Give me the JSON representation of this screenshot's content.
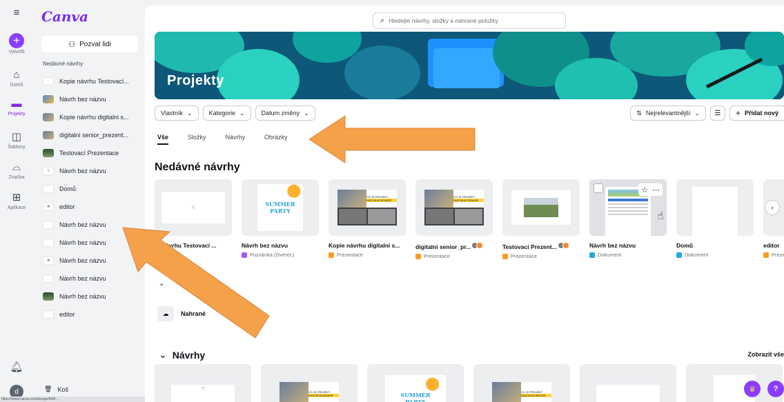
{
  "rail": {
    "create_label": "Vytvořit",
    "home_label": "Domů",
    "projects_label": "Projekty",
    "templates_label": "Šablony",
    "brand_label": "Značka",
    "apps_label": "Aplikace",
    "user_initial": "d"
  },
  "sidebar": {
    "logo": "Canva",
    "invite_label": "Pozvat lidi",
    "recent_title": "Nedávné návrhy",
    "items": [
      {
        "label": "Kopie návrhu Testovací..."
      },
      {
        "label": "Návrh bez názvu"
      },
      {
        "label": "Kopie návrhu digitalni s..."
      },
      {
        "label": "digitalni senior_prezent..."
      },
      {
        "label": "Testovací Prezentace"
      },
      {
        "label": "Návrh bez názvu"
      },
      {
        "label": "Domů"
      },
      {
        "label": "editor"
      },
      {
        "label": "Návrh bez názvu"
      },
      {
        "label": "Návrh bez názvu"
      },
      {
        "label": "Návrh bez názvu"
      },
      {
        "label": "Návrh bez názvu"
      },
      {
        "label": "Návrh bez názvu"
      },
      {
        "label": "editor"
      }
    ],
    "trash_label": "Koš",
    "status_url": "https://www.canva.com/design/DAF..."
  },
  "search": {
    "placeholder": "Hledejte návrhy, složky a nahrané položky"
  },
  "hero": {
    "title": "Projekty"
  },
  "filters": {
    "owner": "Vlastník",
    "category": "Kategorie",
    "date": "Datum změny",
    "sort": "Nejrelevantnější",
    "add": "Přidat nový"
  },
  "tabs": [
    "Vše",
    "Složky",
    "Návrhy",
    "Obrázky"
  ],
  "recent_heading": "Nedávné návrhy",
  "recent_cards": [
    {
      "title": "pie návrhu Testovací ...",
      "type": "ntace"
    },
    {
      "title": "Návrh bez názvu",
      "type": "Pozvánka (čtverec)"
    },
    {
      "title": "Kopie návrhu digitalni s...",
      "type": "Prezentace"
    },
    {
      "title": "digitalni senior_pr...",
      "type": "Prezentace"
    },
    {
      "title": "Testovací Prezent...",
      "type": "Prezentace"
    },
    {
      "title": "Návrh bez názvu",
      "type": "Dokument"
    },
    {
      "title": "Domů",
      "type": "Dokument"
    },
    {
      "title": "editor",
      "type": "Prezen"
    }
  ],
  "thumb_text": {
    "summer_1": "SUMMER",
    "summer_2": "PARTY",
    "co_je_projekt": "CO JE PROJEKT",
    "digitalni_senior": "DIGITÁLNÍ SENIOR"
  },
  "folder": {
    "name": "Nahrané"
  },
  "designs_heading": "Návrhy",
  "show_all": "Zobrazit vše",
  "colors": {
    "accent": "#8b3dff",
    "arrow": "#f4a14a"
  }
}
